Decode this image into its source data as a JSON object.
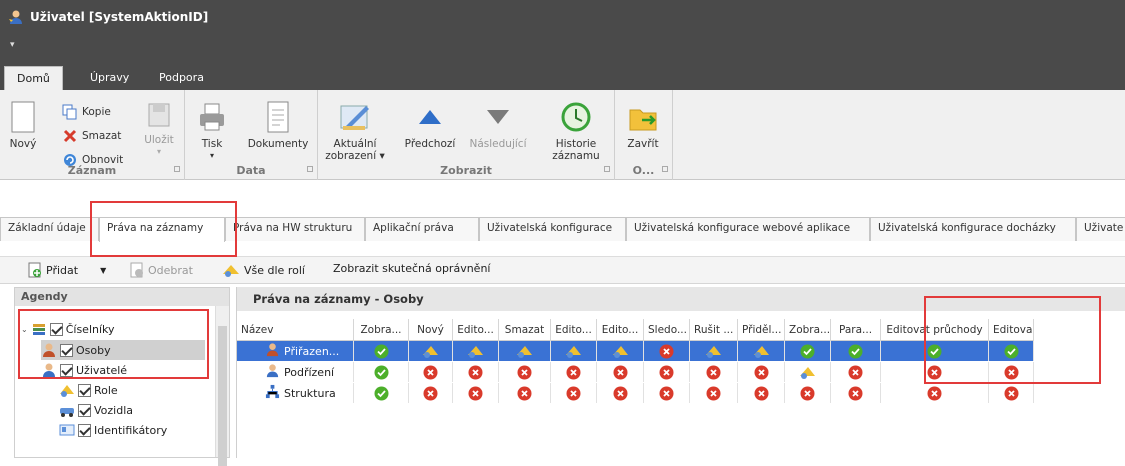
{
  "window": {
    "title": "Uživatel [SystemAktionID]",
    "quick_access": "▾"
  },
  "menu": {
    "tabs": [
      "Domů",
      "Úpravy",
      "Podpora"
    ]
  },
  "ribbon": {
    "record": {
      "new": "Nový",
      "copy": "Kopie",
      "delete": "Smazat",
      "refresh": "Obnovit",
      "save": "Uložit",
      "label": "Záznam"
    },
    "data": {
      "print": "Tisk",
      "documents": "Dokumenty",
      "label": "Data"
    },
    "view": {
      "current": "Aktuální zobrazení ▾",
      "previous": "Předchozí",
      "next": "Následující",
      "history": "Historie záznamu",
      "label": "Zobrazit"
    },
    "close": {
      "close": "Zavřít",
      "label": "O..."
    }
  },
  "doc_tabs": [
    "Základní údaje",
    "Práva na záznamy",
    "Práva na HW strukturu",
    "Aplikační práva",
    "Uživatelská konfigurace",
    "Uživatelská konfigurace webové aplikace",
    "Uživatelská konfigurace docházky",
    "Uživate"
  ],
  "toolbar": {
    "add": "Přidat",
    "remove": "Odebrat",
    "all_by_roles": "Vše dle rolí",
    "show_actual": "Zobrazit skutečná oprávnění"
  },
  "agendas": {
    "header": "Agendy",
    "items": [
      {
        "label": "Číselníky"
      },
      {
        "label": "Osoby"
      },
      {
        "label": "Uživatelé"
      },
      {
        "label": "Role"
      },
      {
        "label": "Vozidla"
      },
      {
        "label": "Identifikátory"
      }
    ]
  },
  "grid": {
    "title": "Práva na záznamy - Osoby",
    "columns": [
      "Název",
      "Zobra...",
      "Nový",
      "Edito...",
      "Smazat",
      "Edito...",
      "Edito...",
      "Sledo...",
      "Rušit ...",
      "Přiděl...",
      "Zobra...",
      "Para...",
      "Editovat průchody",
      "Editova"
    ],
    "rows": [
      {
        "name": "Přiřazen...",
        "cells": [
          "ok",
          "role",
          "role",
          "role",
          "role",
          "role",
          "no",
          "role",
          "role",
          "ok",
          "ok",
          "ok",
          "ok"
        ]
      },
      {
        "name": "Podřízení",
        "cells": [
          "ok",
          "no",
          "no",
          "no",
          "no",
          "no",
          "no",
          "no",
          "no",
          "role",
          "no",
          "no",
          "no"
        ]
      },
      {
        "name": "Struktura",
        "cells": [
          "ok",
          "no",
          "no",
          "no",
          "no",
          "no",
          "no",
          "no",
          "no",
          "no",
          "no",
          "no",
          "no"
        ]
      }
    ]
  },
  "colors": {
    "accent": "#3a72d4",
    "ok": "#4caf2a",
    "no": "#d93a2b",
    "highlight": "#e23a3a"
  }
}
